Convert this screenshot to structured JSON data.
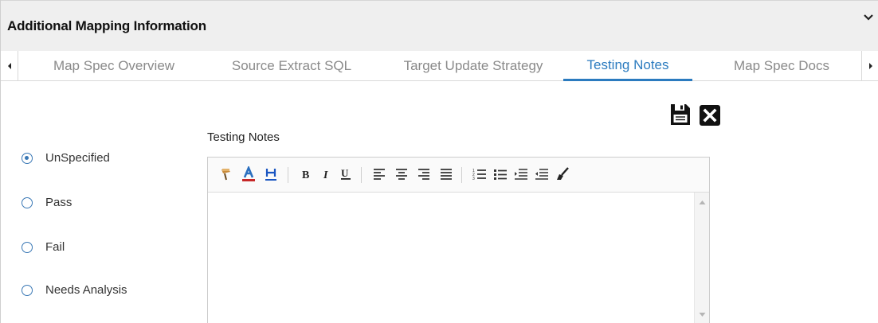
{
  "panel": {
    "title": "Additional Mapping Information",
    "collapse_icon": "chevron-down-icon"
  },
  "tabs": [
    {
      "label": "Map Spec Overview",
      "active": false
    },
    {
      "label": "Source Extract SQL",
      "active": false
    },
    {
      "label": "Target Update Strategy",
      "active": false
    },
    {
      "label": "Testing Notes",
      "active": true
    },
    {
      "label": "Map Spec Docs",
      "active": false
    }
  ],
  "actions": {
    "save_icon": "floppy-disk-icon",
    "close_icon": "close-x-icon"
  },
  "editor": {
    "label": "Testing Notes",
    "content": "",
    "toolbar": [
      "format-painter-icon",
      "font-color-icon",
      "highlight-icon",
      "bold-icon",
      "italic-icon",
      "underline-icon",
      "align-left-icon",
      "align-center-icon",
      "align-right-icon",
      "justify-icon",
      "numbered-list-icon",
      "bulleted-list-icon",
      "indent-icon",
      "outdent-icon",
      "clear-format-icon"
    ]
  },
  "test_status": {
    "options": [
      "UnSpecified",
      "Pass",
      "Fail",
      "Needs Analysis"
    ],
    "selected": "UnSpecified"
  },
  "colors": {
    "accent": "#2b7bbf",
    "header_bg": "#efefef",
    "font_color_bar": "#c62828",
    "highlight_letter": "#1a56c2"
  }
}
